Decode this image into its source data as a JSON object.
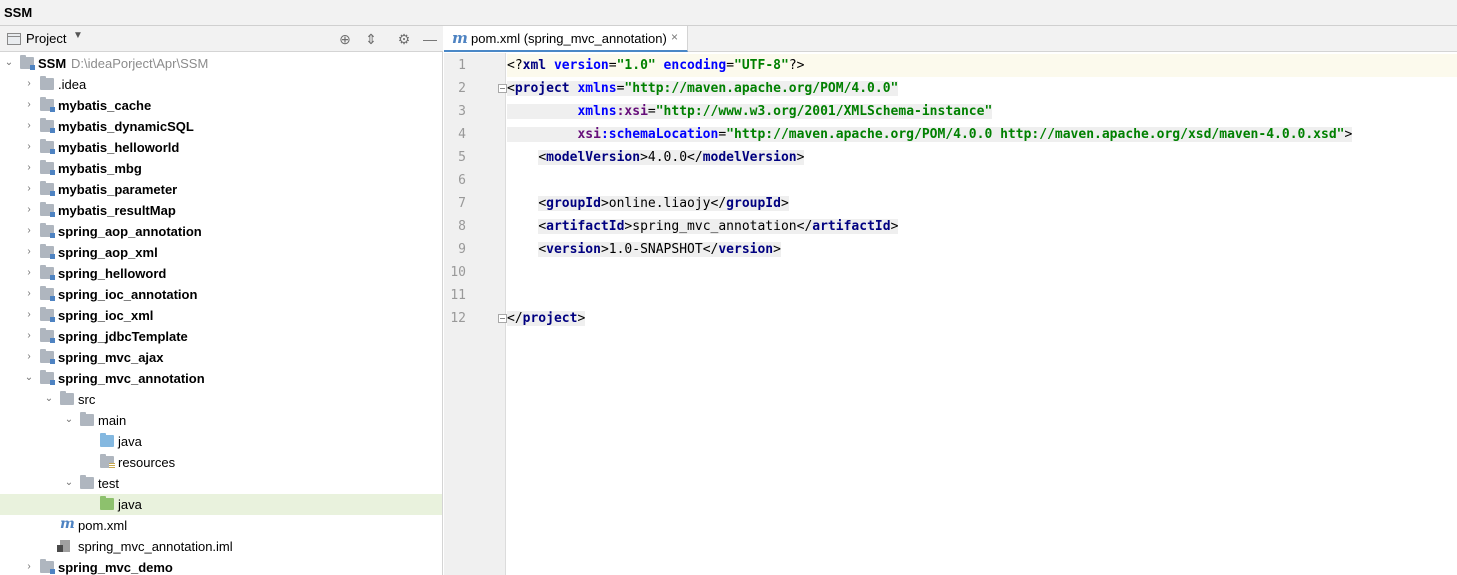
{
  "window": {
    "title": "SSM"
  },
  "project_panel": {
    "title": "Project",
    "buttons": [
      {
        "name": "locate-icon",
        "glyph": "⊕"
      },
      {
        "name": "collapse-all-icon",
        "glyph": "⇕"
      },
      {
        "name": "gear-icon",
        "glyph": "⚙"
      },
      {
        "name": "minimize-icon",
        "glyph": "—"
      }
    ],
    "root": {
      "name": "SSM",
      "path": "D:\\ideaPorject\\Apr\\SSM"
    },
    "items": [
      {
        "label": ".idea",
        "type": "folder",
        "bold": false
      },
      {
        "label": "mybatis_cache",
        "type": "module",
        "bold": true
      },
      {
        "label": "mybatis_dynamicSQL",
        "type": "module",
        "bold": true
      },
      {
        "label": "mybatis_helloworld",
        "type": "module",
        "bold": true
      },
      {
        "label": "mybatis_mbg",
        "type": "module",
        "bold": true
      },
      {
        "label": "mybatis_parameter",
        "type": "module",
        "bold": true
      },
      {
        "label": "mybatis_resultMap",
        "type": "module",
        "bold": true
      },
      {
        "label": "spring_aop_annotation",
        "type": "module",
        "bold": true
      },
      {
        "label": "spring_aop_xml",
        "type": "module",
        "bold": true
      },
      {
        "label": "spring_helloword",
        "type": "module",
        "bold": true
      },
      {
        "label": "spring_ioc_annotation",
        "type": "module",
        "bold": true
      },
      {
        "label": "spring_ioc_xml",
        "type": "module",
        "bold": true
      },
      {
        "label": "spring_jdbcTemplate",
        "type": "module",
        "bold": true
      },
      {
        "label": "spring_mvc_ajax",
        "type": "module",
        "bold": true
      },
      {
        "label": "spring_mvc_annotation",
        "type": "module",
        "bold": true
      },
      {
        "label": "src",
        "type": "folder",
        "bold": false
      },
      {
        "label": "main",
        "type": "folder",
        "bold": false
      },
      {
        "label": "java",
        "type": "source-folder",
        "bold": false
      },
      {
        "label": "resources",
        "type": "resources-folder",
        "bold": false
      },
      {
        "label": "test",
        "type": "folder",
        "bold": false
      },
      {
        "label": "java",
        "type": "test-folder",
        "bold": false
      },
      {
        "label": "pom.xml",
        "type": "maven-file",
        "bold": false
      },
      {
        "label": "spring_mvc_annotation.iml",
        "type": "iml-file",
        "bold": false
      },
      {
        "label": "spring_mvc_demo",
        "type": "module",
        "bold": true
      }
    ]
  },
  "editor": {
    "tab": {
      "label": "pom.xml (spring_mvc_annotation)",
      "close": "×",
      "icon": "m"
    },
    "line_numbers": [
      "1",
      "2",
      "3",
      "4",
      "5",
      "6",
      "7",
      "8",
      "9",
      "10",
      "11",
      "12"
    ],
    "code": {
      "l1": {
        "a": "<?",
        "b": "xml",
        "c": " version",
        "d": "=",
        "e": "\"1.0\"",
        "f": " encoding",
        "g": "=",
        "h": "\"UTF-8\"",
        "i": "?>"
      },
      "l2": {
        "a": "<",
        "b": "project",
        "c": " xmlns",
        "d": "=",
        "e": "\"http://maven.apache.org/POM/4.0.0\""
      },
      "l3": {
        "indent": "         ",
        "a": "xmlns",
        "b": ":xsi",
        "c": "=",
        "d": "\"http://www.w3.org/2001/XMLSchema-instance\""
      },
      "l4": {
        "indent": "         ",
        "a": "xsi",
        "b": ":schemaLocation",
        "c": "=",
        "d": "\"http://maven.apache.org/POM/4.0.0 http://maven.apache.org/xsd/maven-4.0.0.xsd\"",
        "e": ">"
      },
      "l5": {
        "indent": "    ",
        "a": "<",
        "b": "modelVersion",
        "c": ">",
        "d": "4.0.0",
        "e": "</",
        "f": "modelVersion",
        "g": ">"
      },
      "l7": {
        "indent": "    ",
        "a": "<",
        "b": "groupId",
        "c": ">",
        "d": "online.liaojy",
        "e": "</",
        "f": "groupId",
        "g": ">"
      },
      "l8": {
        "indent": "    ",
        "a": "<",
        "b": "artifactId",
        "c": ">",
        "d": "spring_mvc_annotation",
        "e": "</",
        "f": "artifactId",
        "g": ">"
      },
      "l9": {
        "indent": "    ",
        "a": "<",
        "b": "version",
        "c": ">",
        "d": "1.0-SNAPSHOT",
        "e": "</",
        "f": "version",
        "g": ">"
      },
      "l12": {
        "a": "</",
        "b": "project",
        "c": ">"
      }
    }
  }
}
